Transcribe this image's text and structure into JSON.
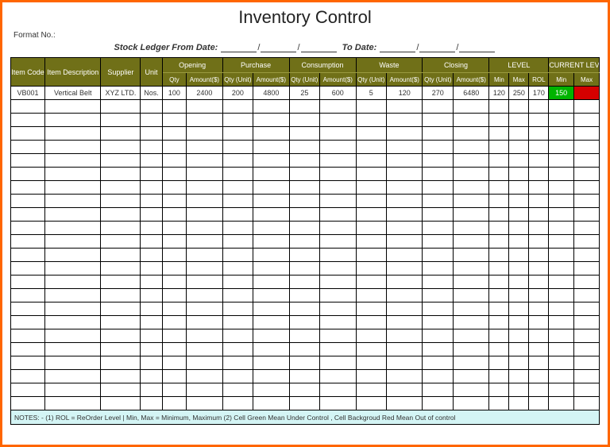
{
  "title": "Inventory Control",
  "format_label": "Format No.:",
  "date_line": {
    "prefix": "Stock Ledger From Date:",
    "to": "To Date:"
  },
  "headers": {
    "item_code": "Item Code",
    "item_desc": "Item Description",
    "supplier": "Supplier",
    "unit": "Unit",
    "groups": {
      "opening": "Opening",
      "purchase": "Purchase",
      "consumption": "Consumption",
      "waste": "Waste",
      "closing": "Closing",
      "level": "LEVEL",
      "current": "CURRENT LEVEL"
    },
    "sub": {
      "qty": "Qty",
      "amount": "Amount($)",
      "qty_unit": "Qty (Unit)",
      "min": "Min",
      "max": "Max",
      "rol": "ROL"
    }
  },
  "rows": [
    {
      "item_code": "VB001",
      "item_desc": "Vertical Belt",
      "supplier": "XYZ LTD.",
      "unit": "Nos.",
      "open_qty": "100",
      "open_amt": "2400",
      "pur_qty": "200",
      "pur_amt": "4800",
      "con_qty": "25",
      "con_amt": "600",
      "waste_qty": "5",
      "waste_amt": "120",
      "close_qty": "270",
      "close_amt": "6480",
      "lvl_min": "120",
      "lvl_max": "250",
      "lvl_rol": "170",
      "cur_min": "150",
      "cur_max": "",
      "cur_min_status": "ok",
      "cur_max_status": "bad"
    }
  ],
  "empty_row_count": 23,
  "notes": "NOTES: - (1) ROL = ReOrder Level | Min, Max = Minimum, Maximum    (2) Cell Green Mean Under Control , Cell Backgroud Red Mean Out of control"
}
